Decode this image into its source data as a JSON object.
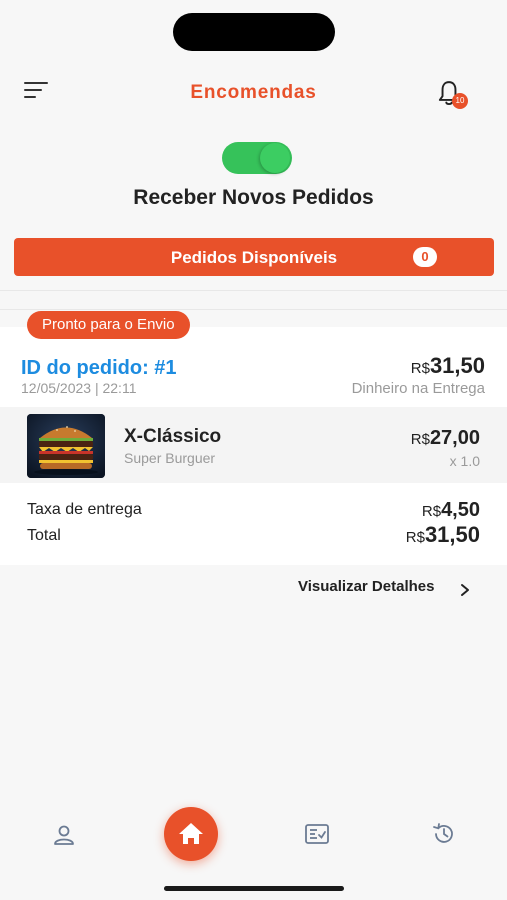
{
  "header": {
    "title": "Encomendas",
    "notification_count": "10"
  },
  "receive_orders": {
    "label": "Receber Novos Pedidos",
    "enabled": true
  },
  "available_orders": {
    "label": "Pedidos Disponíveis",
    "count": "0"
  },
  "order": {
    "status": "Pronto para o Envio",
    "id_label": "ID do pedido: #1",
    "date": "12/05/2023 | 22:11",
    "total_currency": "R$",
    "total_amount": "31,50",
    "payment_method": "Dinheiro na Entrega",
    "items": [
      {
        "name": "X-Clássico",
        "restaurant": "Super Burguer",
        "price_currency": "R$",
        "price_amount": "27,00",
        "quantity": "x 1.0"
      }
    ],
    "delivery_fee_label": "Taxa de entrega",
    "delivery_fee_currency": "R$",
    "delivery_fee_amount": "4,50",
    "total_label": "Total",
    "grand_total_currency": "R$",
    "grand_total_amount": "31,50",
    "details_link": "Visualizar Detalhes"
  },
  "bottom_nav": {
    "items": [
      "profile-icon",
      "home-icon",
      "orders-icon",
      "history-icon"
    ],
    "active": "home-icon"
  },
  "colors": {
    "accent": "#e8512a",
    "toggle_on": "#36c25a",
    "link_blue": "#1d8ce0"
  }
}
